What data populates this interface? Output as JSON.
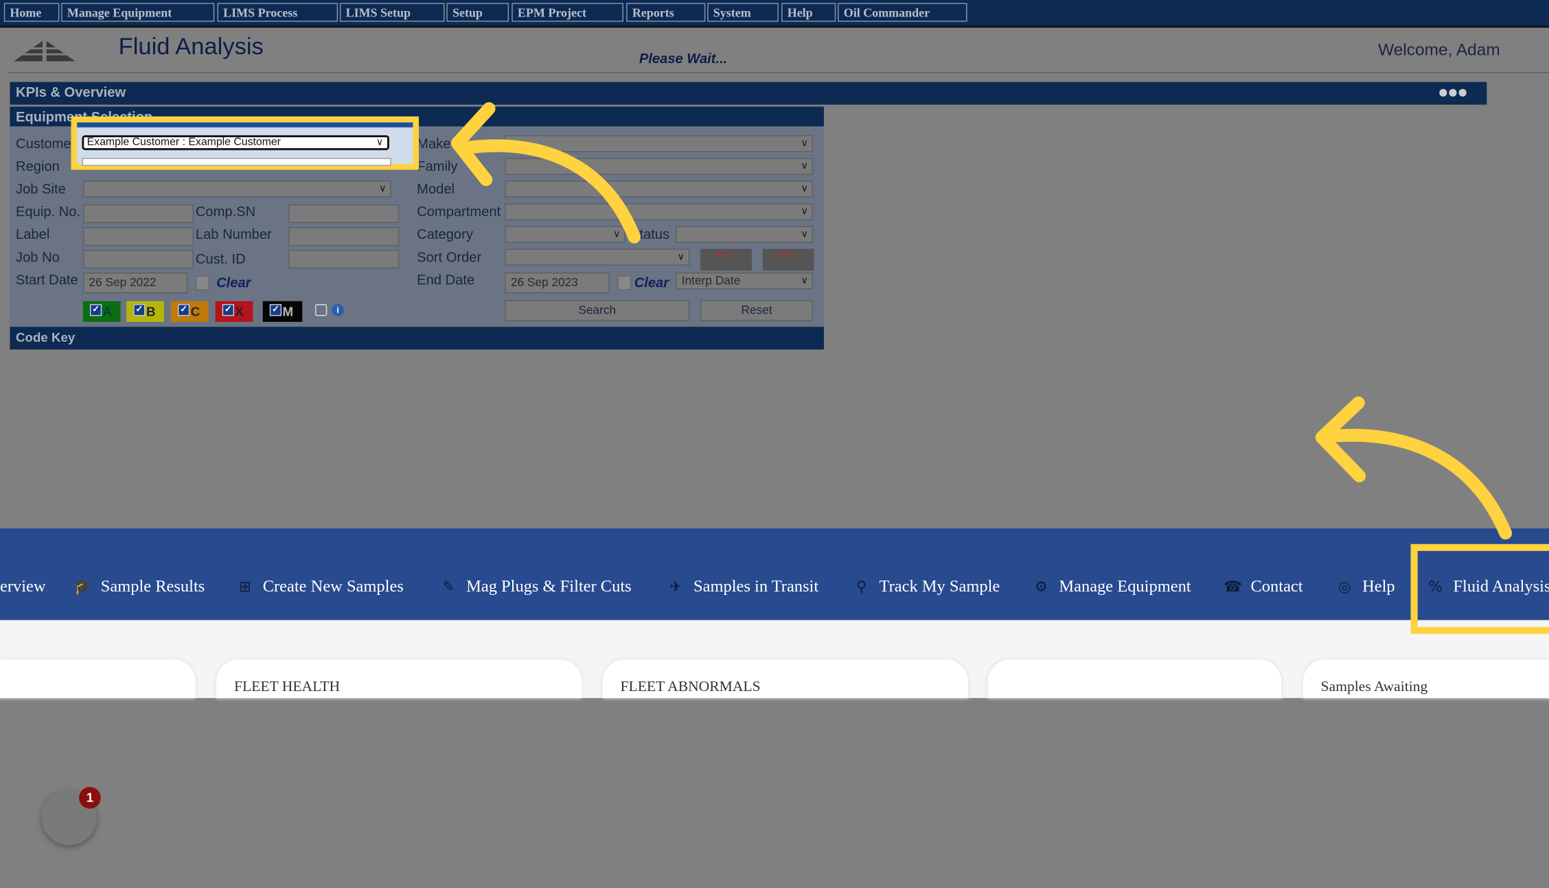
{
  "top_menu": [
    "Home",
    "Manage Equipment",
    "LIMS Process",
    "LIMS Setup",
    "Setup",
    "EPM Project",
    "Reports",
    "System",
    "Help",
    "Oil Commander"
  ],
  "header": {
    "title": "Fluid Analysis",
    "status": "Please Wait...",
    "welcome": "Welcome, Adam"
  },
  "kpi": {
    "title": "KPIs & Overview",
    "menu_icon": "ellipsis-icon"
  },
  "equipment_selection": {
    "title": "Equipment Selection",
    "labels": {
      "customer": "Customer",
      "region": "Region",
      "job_site": "Job Site",
      "equip_no": "Equip. No.",
      "comp_sn": "Comp.SN",
      "label": "Label",
      "lab_number": "Lab Number",
      "job_no": "Job No",
      "cust_id": "Cust. ID",
      "start_date": "Start Date",
      "make": "Make",
      "family": "Family",
      "model": "Model",
      "compartment": "Compartment",
      "category": "Category",
      "status": "Status",
      "sort_order": "Sort Order",
      "end_date": "End Date"
    },
    "customer_value": "Example Customer : Example Customer",
    "start_date": "26 Sep 2022",
    "end_date": "26 Sep 2023",
    "clear": "Clear",
    "date_type": "Interp Date",
    "codes": [
      {
        "label": "A",
        "color": "#0b6e12"
      },
      {
        "label": "B",
        "color": "#b6b60a"
      },
      {
        "label": "C",
        "color": "#c07a0a"
      },
      {
        "label": "X",
        "color": "#b5141a"
      },
      {
        "label": "M",
        "color": "#050505"
      }
    ],
    "search": "Search",
    "reset": "Reset",
    "sort_az": "A Z",
    "sort_za": "Z A"
  },
  "code_key": "Code Key",
  "bottom_nav": [
    {
      "label": "erview",
      "icon": ""
    },
    {
      "label": "Sample Results",
      "icon": "graduation-cap-icon"
    },
    {
      "label": "Create New Samples",
      "icon": "plus-square-icon"
    },
    {
      "label": "Mag Plugs & Filter Cuts",
      "icon": "eyedropper-icon"
    },
    {
      "label": "Samples in Transit",
      "icon": "plane-icon"
    },
    {
      "label": "Track My Sample",
      "icon": "map-pin-icon"
    },
    {
      "label": "Manage Equipment",
      "icon": "gears-icon"
    },
    {
      "label": "Contact",
      "icon": "phone-icon"
    },
    {
      "label": "Help",
      "icon": "life-ring-icon"
    },
    {
      "label": "Fluid Analysis",
      "icon": "percent-icon"
    }
  ],
  "cards": [
    "",
    "FLEET HEALTH",
    "FLEET ABNORMALS",
    "",
    "Samples Awaiting"
  ],
  "chat_badge": "1",
  "colors": {
    "highlight": "#ffd23f",
    "nav_blue": "#284a8e",
    "dark_navy": "#0c2a52"
  }
}
